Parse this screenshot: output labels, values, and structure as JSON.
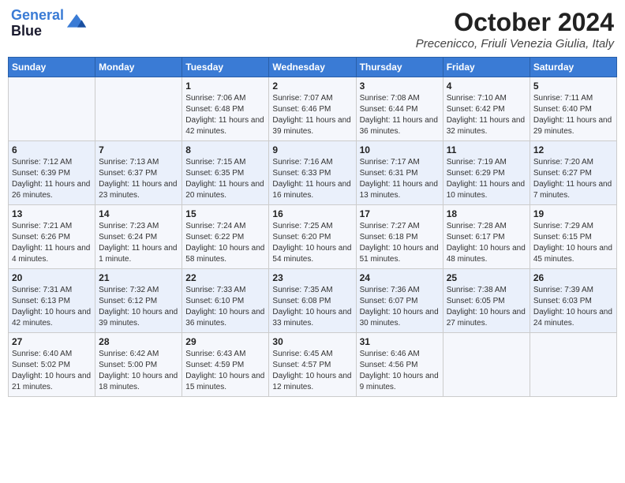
{
  "header": {
    "logo_line1": "General",
    "logo_line2": "Blue",
    "title": "October 2024",
    "subtitle": "Precenicco, Friuli Venezia Giulia, Italy"
  },
  "days_of_week": [
    "Sunday",
    "Monday",
    "Tuesday",
    "Wednesday",
    "Thursday",
    "Friday",
    "Saturday"
  ],
  "weeks": [
    [
      {
        "day": "",
        "info": ""
      },
      {
        "day": "",
        "info": ""
      },
      {
        "day": "1",
        "info": "Sunrise: 7:06 AM\nSunset: 6:48 PM\nDaylight: 11 hours and 42 minutes."
      },
      {
        "day": "2",
        "info": "Sunrise: 7:07 AM\nSunset: 6:46 PM\nDaylight: 11 hours and 39 minutes."
      },
      {
        "day": "3",
        "info": "Sunrise: 7:08 AM\nSunset: 6:44 PM\nDaylight: 11 hours and 36 minutes."
      },
      {
        "day": "4",
        "info": "Sunrise: 7:10 AM\nSunset: 6:42 PM\nDaylight: 11 hours and 32 minutes."
      },
      {
        "day": "5",
        "info": "Sunrise: 7:11 AM\nSunset: 6:40 PM\nDaylight: 11 hours and 29 minutes."
      }
    ],
    [
      {
        "day": "6",
        "info": "Sunrise: 7:12 AM\nSunset: 6:39 PM\nDaylight: 11 hours and 26 minutes."
      },
      {
        "day": "7",
        "info": "Sunrise: 7:13 AM\nSunset: 6:37 PM\nDaylight: 11 hours and 23 minutes."
      },
      {
        "day": "8",
        "info": "Sunrise: 7:15 AM\nSunset: 6:35 PM\nDaylight: 11 hours and 20 minutes."
      },
      {
        "day": "9",
        "info": "Sunrise: 7:16 AM\nSunset: 6:33 PM\nDaylight: 11 hours and 16 minutes."
      },
      {
        "day": "10",
        "info": "Sunrise: 7:17 AM\nSunset: 6:31 PM\nDaylight: 11 hours and 13 minutes."
      },
      {
        "day": "11",
        "info": "Sunrise: 7:19 AM\nSunset: 6:29 PM\nDaylight: 11 hours and 10 minutes."
      },
      {
        "day": "12",
        "info": "Sunrise: 7:20 AM\nSunset: 6:27 PM\nDaylight: 11 hours and 7 minutes."
      }
    ],
    [
      {
        "day": "13",
        "info": "Sunrise: 7:21 AM\nSunset: 6:26 PM\nDaylight: 11 hours and 4 minutes."
      },
      {
        "day": "14",
        "info": "Sunrise: 7:23 AM\nSunset: 6:24 PM\nDaylight: 11 hours and 1 minute."
      },
      {
        "day": "15",
        "info": "Sunrise: 7:24 AM\nSunset: 6:22 PM\nDaylight: 10 hours and 58 minutes."
      },
      {
        "day": "16",
        "info": "Sunrise: 7:25 AM\nSunset: 6:20 PM\nDaylight: 10 hours and 54 minutes."
      },
      {
        "day": "17",
        "info": "Sunrise: 7:27 AM\nSunset: 6:18 PM\nDaylight: 10 hours and 51 minutes."
      },
      {
        "day": "18",
        "info": "Sunrise: 7:28 AM\nSunset: 6:17 PM\nDaylight: 10 hours and 48 minutes."
      },
      {
        "day": "19",
        "info": "Sunrise: 7:29 AM\nSunset: 6:15 PM\nDaylight: 10 hours and 45 minutes."
      }
    ],
    [
      {
        "day": "20",
        "info": "Sunrise: 7:31 AM\nSunset: 6:13 PM\nDaylight: 10 hours and 42 minutes."
      },
      {
        "day": "21",
        "info": "Sunrise: 7:32 AM\nSunset: 6:12 PM\nDaylight: 10 hours and 39 minutes."
      },
      {
        "day": "22",
        "info": "Sunrise: 7:33 AM\nSunset: 6:10 PM\nDaylight: 10 hours and 36 minutes."
      },
      {
        "day": "23",
        "info": "Sunrise: 7:35 AM\nSunset: 6:08 PM\nDaylight: 10 hours and 33 minutes."
      },
      {
        "day": "24",
        "info": "Sunrise: 7:36 AM\nSunset: 6:07 PM\nDaylight: 10 hours and 30 minutes."
      },
      {
        "day": "25",
        "info": "Sunrise: 7:38 AM\nSunset: 6:05 PM\nDaylight: 10 hours and 27 minutes."
      },
      {
        "day": "26",
        "info": "Sunrise: 7:39 AM\nSunset: 6:03 PM\nDaylight: 10 hours and 24 minutes."
      }
    ],
    [
      {
        "day": "27",
        "info": "Sunrise: 6:40 AM\nSunset: 5:02 PM\nDaylight: 10 hours and 21 minutes."
      },
      {
        "day": "28",
        "info": "Sunrise: 6:42 AM\nSunset: 5:00 PM\nDaylight: 10 hours and 18 minutes."
      },
      {
        "day": "29",
        "info": "Sunrise: 6:43 AM\nSunset: 4:59 PM\nDaylight: 10 hours and 15 minutes."
      },
      {
        "day": "30",
        "info": "Sunrise: 6:45 AM\nSunset: 4:57 PM\nDaylight: 10 hours and 12 minutes."
      },
      {
        "day": "31",
        "info": "Sunrise: 6:46 AM\nSunset: 4:56 PM\nDaylight: 10 hours and 9 minutes."
      },
      {
        "day": "",
        "info": ""
      },
      {
        "day": "",
        "info": ""
      }
    ]
  ]
}
